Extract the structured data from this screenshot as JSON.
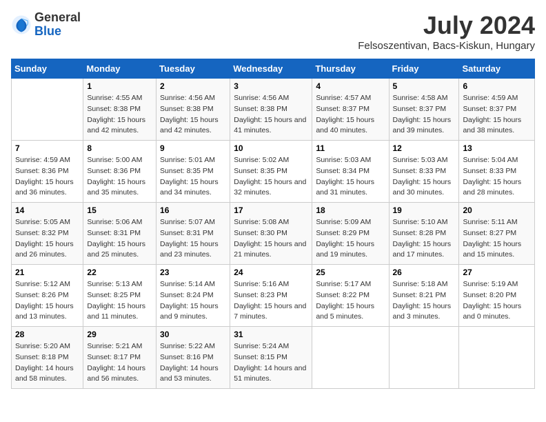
{
  "header": {
    "logo_general": "General",
    "logo_blue": "Blue",
    "title": "July 2024",
    "subtitle": "Felsoszentivan, Bacs-Kiskun, Hungary"
  },
  "columns": [
    "Sunday",
    "Monday",
    "Tuesday",
    "Wednesday",
    "Thursday",
    "Friday",
    "Saturday"
  ],
  "weeks": [
    [
      {
        "day": "",
        "sunrise": "",
        "sunset": "",
        "daylight": ""
      },
      {
        "day": "1",
        "sunrise": "Sunrise: 4:55 AM",
        "sunset": "Sunset: 8:38 PM",
        "daylight": "Daylight: 15 hours and 42 minutes."
      },
      {
        "day": "2",
        "sunrise": "Sunrise: 4:56 AM",
        "sunset": "Sunset: 8:38 PM",
        "daylight": "Daylight: 15 hours and 42 minutes."
      },
      {
        "day": "3",
        "sunrise": "Sunrise: 4:56 AM",
        "sunset": "Sunset: 8:38 PM",
        "daylight": "Daylight: 15 hours and 41 minutes."
      },
      {
        "day": "4",
        "sunrise": "Sunrise: 4:57 AM",
        "sunset": "Sunset: 8:37 PM",
        "daylight": "Daylight: 15 hours and 40 minutes."
      },
      {
        "day": "5",
        "sunrise": "Sunrise: 4:58 AM",
        "sunset": "Sunset: 8:37 PM",
        "daylight": "Daylight: 15 hours and 39 minutes."
      },
      {
        "day": "6",
        "sunrise": "Sunrise: 4:59 AM",
        "sunset": "Sunset: 8:37 PM",
        "daylight": "Daylight: 15 hours and 38 minutes."
      }
    ],
    [
      {
        "day": "7",
        "sunrise": "Sunrise: 4:59 AM",
        "sunset": "Sunset: 8:36 PM",
        "daylight": "Daylight: 15 hours and 36 minutes."
      },
      {
        "day": "8",
        "sunrise": "Sunrise: 5:00 AM",
        "sunset": "Sunset: 8:36 PM",
        "daylight": "Daylight: 15 hours and 35 minutes."
      },
      {
        "day": "9",
        "sunrise": "Sunrise: 5:01 AM",
        "sunset": "Sunset: 8:35 PM",
        "daylight": "Daylight: 15 hours and 34 minutes."
      },
      {
        "day": "10",
        "sunrise": "Sunrise: 5:02 AM",
        "sunset": "Sunset: 8:35 PM",
        "daylight": "Daylight: 15 hours and 32 minutes."
      },
      {
        "day": "11",
        "sunrise": "Sunrise: 5:03 AM",
        "sunset": "Sunset: 8:34 PM",
        "daylight": "Daylight: 15 hours and 31 minutes."
      },
      {
        "day": "12",
        "sunrise": "Sunrise: 5:03 AM",
        "sunset": "Sunset: 8:33 PM",
        "daylight": "Daylight: 15 hours and 30 minutes."
      },
      {
        "day": "13",
        "sunrise": "Sunrise: 5:04 AM",
        "sunset": "Sunset: 8:33 PM",
        "daylight": "Daylight: 15 hours and 28 minutes."
      }
    ],
    [
      {
        "day": "14",
        "sunrise": "Sunrise: 5:05 AM",
        "sunset": "Sunset: 8:32 PM",
        "daylight": "Daylight: 15 hours and 26 minutes."
      },
      {
        "day": "15",
        "sunrise": "Sunrise: 5:06 AM",
        "sunset": "Sunset: 8:31 PM",
        "daylight": "Daylight: 15 hours and 25 minutes."
      },
      {
        "day": "16",
        "sunrise": "Sunrise: 5:07 AM",
        "sunset": "Sunset: 8:31 PM",
        "daylight": "Daylight: 15 hours and 23 minutes."
      },
      {
        "day": "17",
        "sunrise": "Sunrise: 5:08 AM",
        "sunset": "Sunset: 8:30 PM",
        "daylight": "Daylight: 15 hours and 21 minutes."
      },
      {
        "day": "18",
        "sunrise": "Sunrise: 5:09 AM",
        "sunset": "Sunset: 8:29 PM",
        "daylight": "Daylight: 15 hours and 19 minutes."
      },
      {
        "day": "19",
        "sunrise": "Sunrise: 5:10 AM",
        "sunset": "Sunset: 8:28 PM",
        "daylight": "Daylight: 15 hours and 17 minutes."
      },
      {
        "day": "20",
        "sunrise": "Sunrise: 5:11 AM",
        "sunset": "Sunset: 8:27 PM",
        "daylight": "Daylight: 15 hours and 15 minutes."
      }
    ],
    [
      {
        "day": "21",
        "sunrise": "Sunrise: 5:12 AM",
        "sunset": "Sunset: 8:26 PM",
        "daylight": "Daylight: 15 hours and 13 minutes."
      },
      {
        "day": "22",
        "sunrise": "Sunrise: 5:13 AM",
        "sunset": "Sunset: 8:25 PM",
        "daylight": "Daylight: 15 hours and 11 minutes."
      },
      {
        "day": "23",
        "sunrise": "Sunrise: 5:14 AM",
        "sunset": "Sunset: 8:24 PM",
        "daylight": "Daylight: 15 hours and 9 minutes."
      },
      {
        "day": "24",
        "sunrise": "Sunrise: 5:16 AM",
        "sunset": "Sunset: 8:23 PM",
        "daylight": "Daylight: 15 hours and 7 minutes."
      },
      {
        "day": "25",
        "sunrise": "Sunrise: 5:17 AM",
        "sunset": "Sunset: 8:22 PM",
        "daylight": "Daylight: 15 hours and 5 minutes."
      },
      {
        "day": "26",
        "sunrise": "Sunrise: 5:18 AM",
        "sunset": "Sunset: 8:21 PM",
        "daylight": "Daylight: 15 hours and 3 minutes."
      },
      {
        "day": "27",
        "sunrise": "Sunrise: 5:19 AM",
        "sunset": "Sunset: 8:20 PM",
        "daylight": "Daylight: 15 hours and 0 minutes."
      }
    ],
    [
      {
        "day": "28",
        "sunrise": "Sunrise: 5:20 AM",
        "sunset": "Sunset: 8:18 PM",
        "daylight": "Daylight: 14 hours and 58 minutes."
      },
      {
        "day": "29",
        "sunrise": "Sunrise: 5:21 AM",
        "sunset": "Sunset: 8:17 PM",
        "daylight": "Daylight: 14 hours and 56 minutes."
      },
      {
        "day": "30",
        "sunrise": "Sunrise: 5:22 AM",
        "sunset": "Sunset: 8:16 PM",
        "daylight": "Daylight: 14 hours and 53 minutes."
      },
      {
        "day": "31",
        "sunrise": "Sunrise: 5:24 AM",
        "sunset": "Sunset: 8:15 PM",
        "daylight": "Daylight: 14 hours and 51 minutes."
      },
      {
        "day": "",
        "sunrise": "",
        "sunset": "",
        "daylight": ""
      },
      {
        "day": "",
        "sunrise": "",
        "sunset": "",
        "daylight": ""
      },
      {
        "day": "",
        "sunrise": "",
        "sunset": "",
        "daylight": ""
      }
    ]
  ]
}
